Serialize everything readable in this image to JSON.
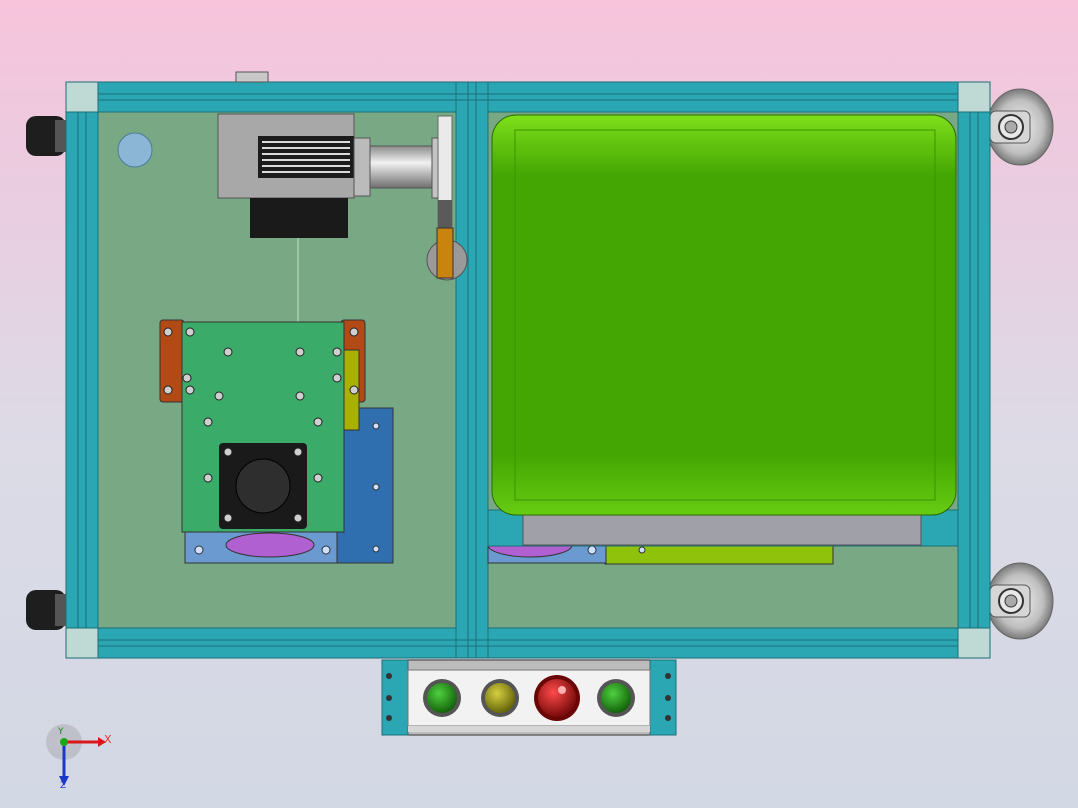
{
  "viewport": {
    "background_top": "#f7c4dc",
    "background_bottom": "#d2d8e4"
  },
  "model": {
    "frame_color": "#2aa7b3",
    "frame_edge_color": "#1c6f78",
    "panel_color": "#79a984",
    "battery_color": "#44a602",
    "motor_color": "#a8a8a8",
    "mount_plate_color": "#3bab6a",
    "bracket_color": "#b24a16",
    "base_plate_color": "#2f6fb0",
    "gear_color": "#b060d0"
  },
  "control_panel": {
    "buttons": [
      {
        "name": "start-button",
        "color": "#1f8a12"
      },
      {
        "name": "pause-button",
        "color": "#9a9a10"
      },
      {
        "name": "emergency-stop-button",
        "color": "#c01818"
      },
      {
        "name": "run-button",
        "color": "#1f8a12"
      }
    ]
  },
  "triad": {
    "x_label": "X",
    "y_label": "Y",
    "z_label": "Z"
  }
}
